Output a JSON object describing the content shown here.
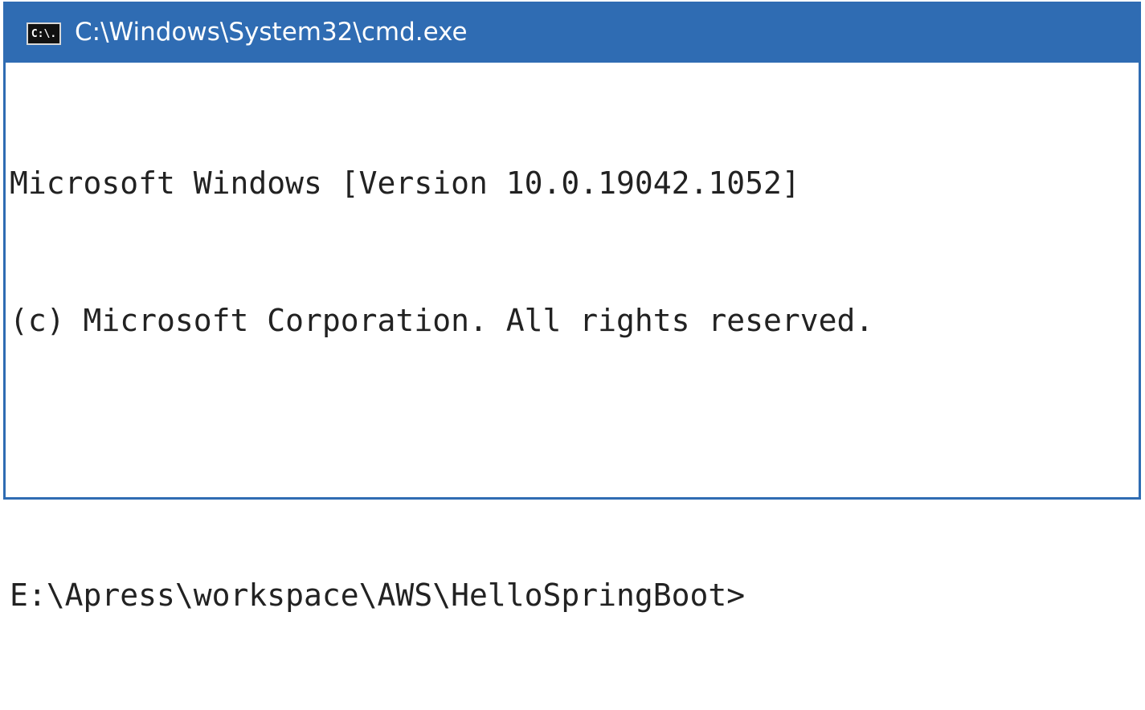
{
  "window": {
    "title": "C:\\Windows\\System32\\cmd.exe",
    "icon_label": "C:\\.",
    "icon": "cmd-prompt-icon",
    "titlebar_color": "#2f6cb3"
  },
  "console": {
    "lines": [
      "Microsoft Windows [Version 10.0.19042.1052]",
      "(c) Microsoft Corporation. All rights reserved.",
      "",
      "E:\\Apress\\workspace\\AWS\\HelloSpringBoot>"
    ]
  }
}
